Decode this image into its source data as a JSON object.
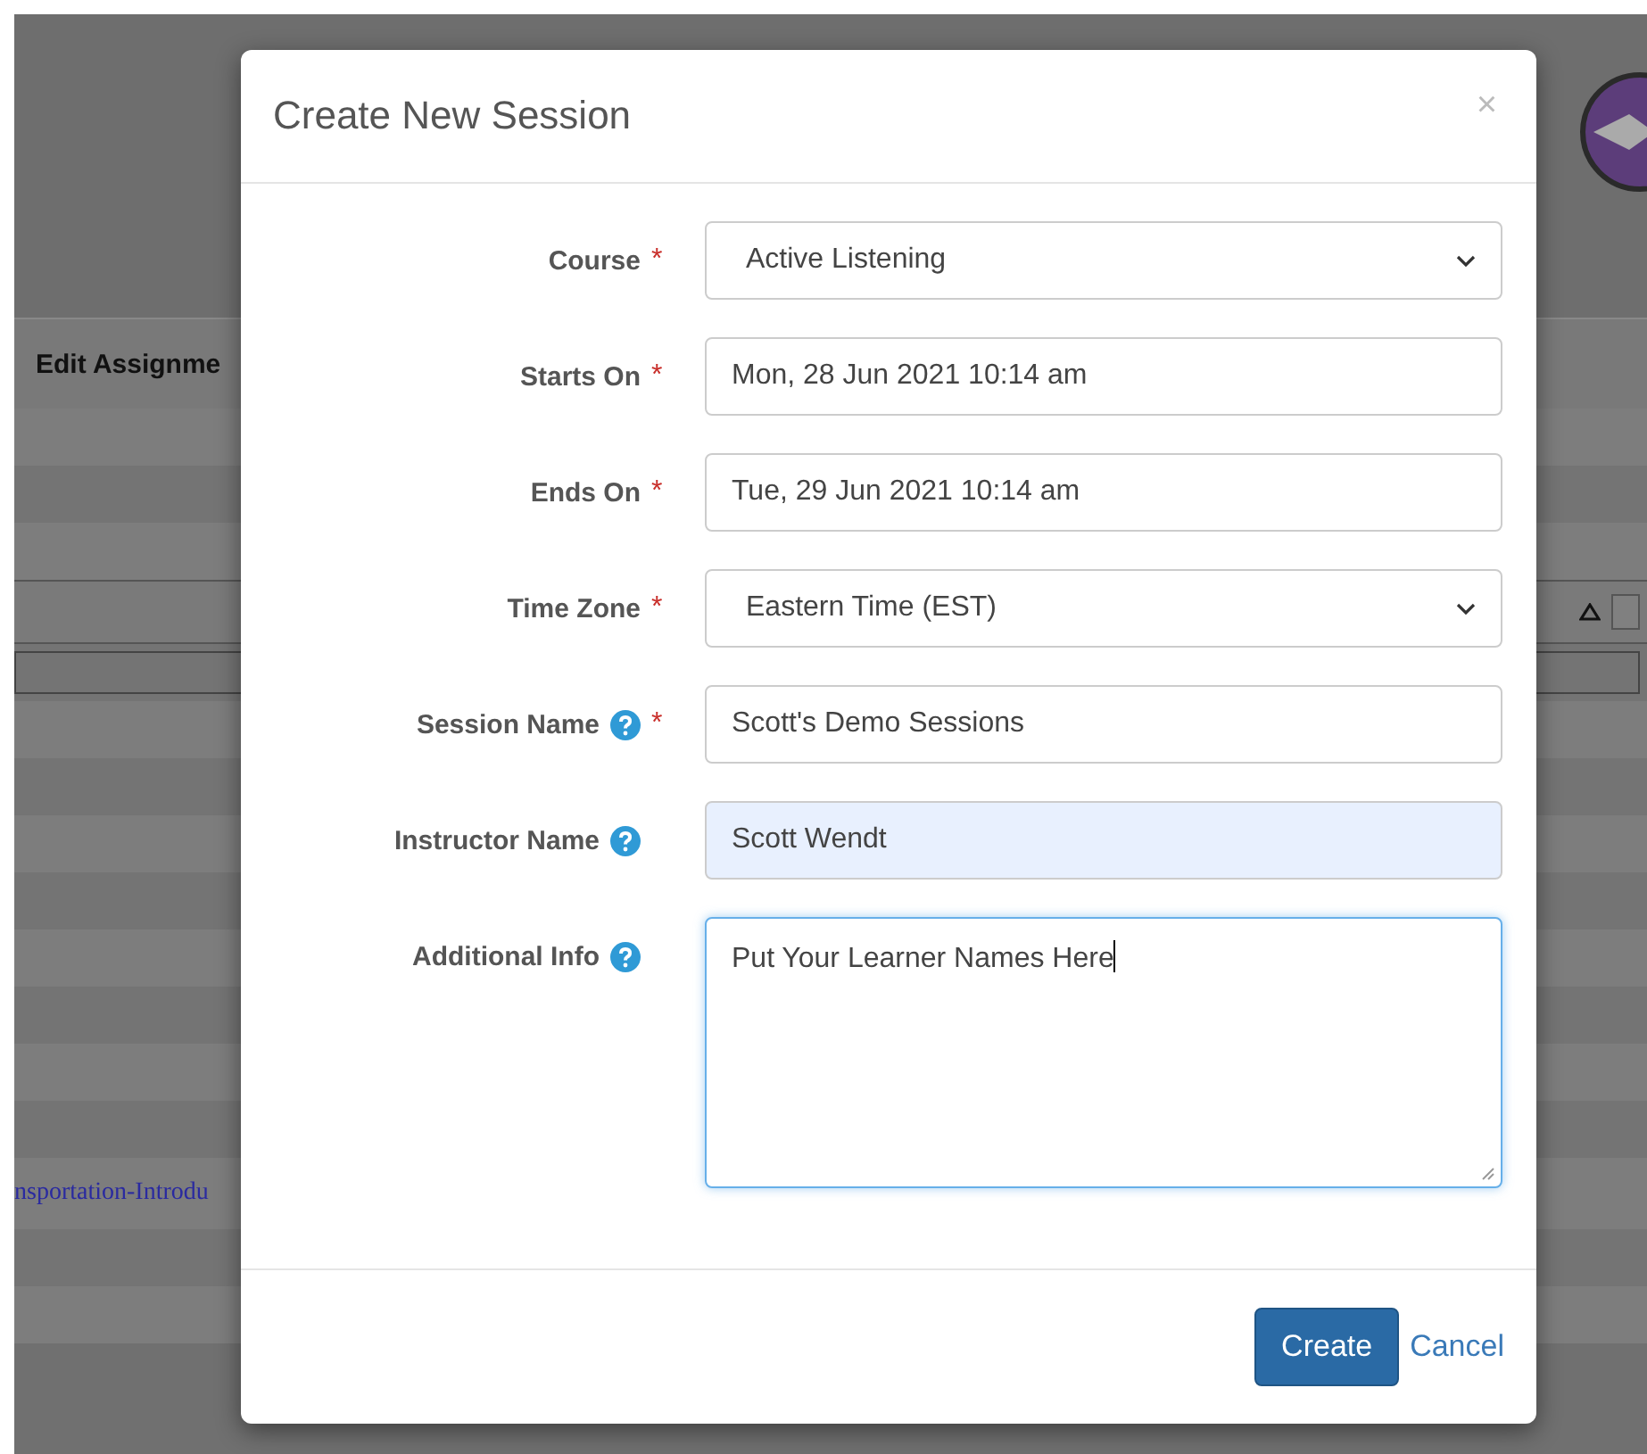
{
  "background": {
    "heading": "Edit Assignme",
    "link": "nsportation-Introdu"
  },
  "dialog": {
    "title": "Create New Session",
    "close": "×",
    "required_mark": "*",
    "fields": [
      {
        "kind": "select",
        "label": "Course",
        "required": true,
        "help": false,
        "value": "Active Listening",
        "highlighted": false,
        "focused": false
      },
      {
        "kind": "text",
        "label": "Starts On",
        "required": true,
        "help": false,
        "value": "Mon, 28 Jun 2021 10:14 am",
        "highlighted": false,
        "focused": false
      },
      {
        "kind": "text",
        "label": "Ends On",
        "required": true,
        "help": false,
        "value": "Tue, 29 Jun 2021 10:14 am",
        "highlighted": false,
        "focused": false
      },
      {
        "kind": "select",
        "label": "Time Zone",
        "required": true,
        "help": false,
        "value": "Eastern Time (EST)",
        "highlighted": false,
        "focused": false
      },
      {
        "kind": "text",
        "label": "Session Name",
        "required": true,
        "help": true,
        "value": "Scott's Demo Sessions",
        "highlighted": false,
        "focused": false
      },
      {
        "kind": "text",
        "label": "Instructor Name",
        "required": false,
        "help": true,
        "value": "Scott Wendt",
        "highlighted": true,
        "focused": false
      },
      {
        "kind": "textarea",
        "label": "Additional Info",
        "required": false,
        "help": true,
        "value": "Put Your Learner Names Here",
        "highlighted": false,
        "focused": true
      }
    ],
    "buttons": [
      {
        "kind": "primary",
        "label": "Create"
      },
      {
        "kind": "link",
        "label": "Cancel"
      }
    ]
  }
}
